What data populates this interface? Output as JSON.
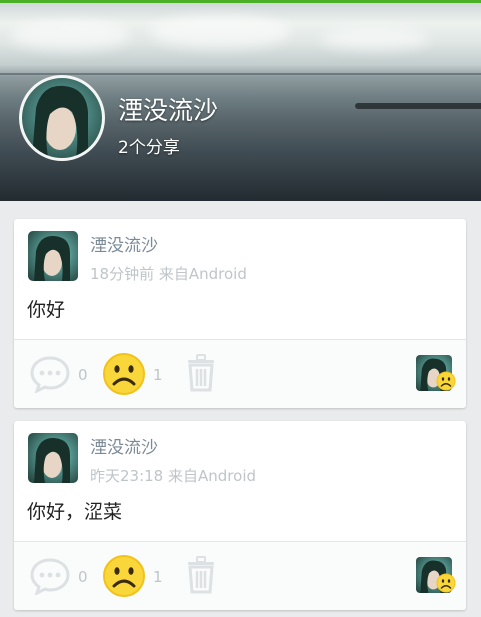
{
  "header": {
    "username": "湮没流沙",
    "share_count": "2个分享"
  },
  "posts": [
    {
      "author": "湮没流沙",
      "time": "18分钟前",
      "source": "来自Android",
      "text": "你好",
      "comment_count": "0",
      "sad_count": "1"
    },
    {
      "author": "湮没流沙",
      "time": "昨天23:18",
      "source": "来自Android",
      "text": "你好，涩菜",
      "comment_count": "0",
      "sad_count": "1"
    }
  ],
  "icons": {
    "comment": "comment-bubble-icon",
    "reaction": "sad-face-icon",
    "delete": "trash-icon"
  },
  "colors": {
    "accent_bar": "#4caf28",
    "reaction_yellow": "#f9c80e",
    "muted_text": "#bfc5c9",
    "author_text": "#7a8a96"
  }
}
